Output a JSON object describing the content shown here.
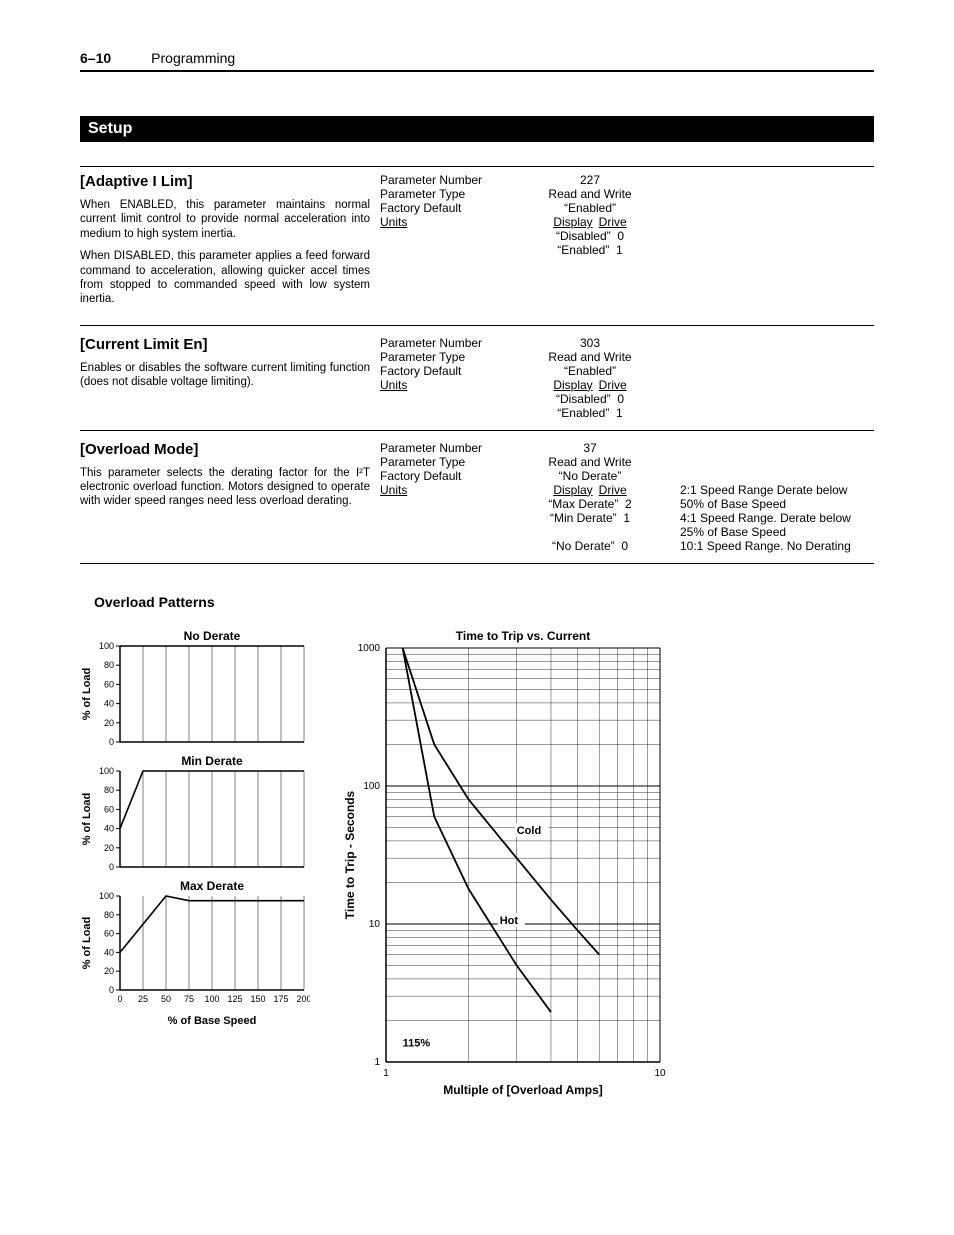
{
  "header": {
    "page_num": "6–10",
    "chapter": "Programming"
  },
  "section_title": "Setup",
  "labels": {
    "param_number": "Parameter Number",
    "param_type": "Parameter Type",
    "factory_default": "Factory Default",
    "units": "Units",
    "display": "Display",
    "drive": "Drive"
  },
  "params": [
    {
      "title": "[Adaptive I Lim]",
      "desc1": "When ENABLED, this parameter maintains normal current limit control to provide normal acceleration into medium to high system inertia.",
      "desc2": "When DISABLED, this parameter applies a feed forward command to acceleration, allowing quicker accel times from stopped to commanded speed with low system inertia.",
      "number": "227",
      "type": "Read and Write",
      "default": "“Enabled”",
      "unit_rows": [
        {
          "u": "“Disabled”",
          "d": "0",
          "desc": ""
        },
        {
          "u": "“Enabled”",
          "d": "1",
          "desc": ""
        }
      ]
    },
    {
      "title": "[Current Limit En]",
      "desc1": "Enables or disables the software current limiting function (does not disable voltage limiting).",
      "desc2": "",
      "number": "303",
      "type": "Read and Write",
      "default": "“Enabled”",
      "unit_rows": [
        {
          "u": "“Disabled”",
          "d": "0",
          "desc": ""
        },
        {
          "u": "“Enabled”",
          "d": "1",
          "desc": ""
        }
      ]
    },
    {
      "title": "[Overload Mode]",
      "desc1": "This parameter selects the derating factor for the I²T electronic overload function. Motors designed to operate with wider speed ranges need less overload derating.",
      "desc2": "",
      "number": "37",
      "type": "Read and Write",
      "default": "“No Derate”",
      "unit_rows": [
        {
          "u": "“Max Derate”",
          "d": "2",
          "desc": "2:1 Speed Range Derate below 50% of Base Speed"
        },
        {
          "u": "“Min Derate”",
          "d": "1",
          "desc": "4:1 Speed Range. Derate below 25% of Base Speed"
        },
        {
          "u": "“No Derate”",
          "d": "0",
          "desc": "10:1 Speed Range. No Derating"
        }
      ]
    }
  ],
  "patterns_title": "Overload Patterns",
  "chart_data": [
    {
      "type": "line",
      "title": "No Derate",
      "xlabel": "% of Base Speed",
      "ylabel": "% of Load",
      "xlim": [
        0,
        200
      ],
      "ylim": [
        0,
        100
      ],
      "xticks": [
        0,
        25,
        50,
        75,
        100,
        125,
        150,
        175,
        200
      ],
      "yticks": [
        0,
        20,
        40,
        60,
        80,
        100
      ],
      "series": [
        {
          "name": "load",
          "x": [
            0,
            200
          ],
          "y": [
            100,
            100
          ]
        }
      ]
    },
    {
      "type": "line",
      "title": "Min Derate",
      "xlabel": "% of Base Speed",
      "ylabel": "% of Load",
      "xlim": [
        0,
        200
      ],
      "ylim": [
        0,
        100
      ],
      "xticks": [
        0,
        25,
        50,
        75,
        100,
        125,
        150,
        175,
        200
      ],
      "yticks": [
        0,
        20,
        40,
        60,
        80,
        100
      ],
      "series": [
        {
          "name": "load",
          "x": [
            0,
            25,
            200
          ],
          "y": [
            40,
            100,
            100
          ]
        }
      ]
    },
    {
      "type": "line",
      "title": "Max Derate",
      "xlabel": "% of Base Speed",
      "ylabel": "% of Load",
      "xlim": [
        0,
        200
      ],
      "ylim": [
        0,
        100
      ],
      "xticks": [
        0,
        25,
        50,
        75,
        100,
        125,
        150,
        175,
        200
      ],
      "yticks": [
        0,
        20,
        40,
        60,
        80,
        100
      ],
      "series": [
        {
          "name": "load",
          "x": [
            0,
            50,
            75,
            200
          ],
          "y": [
            40,
            100,
            95,
            95
          ]
        }
      ]
    },
    {
      "type": "line",
      "title": "Time to Trip vs. Current",
      "xlabel": "Multiple of [Overload Amps]",
      "ylabel": "Time to Trip - Seconds",
      "xlim": [
        1,
        10
      ],
      "ylim": [
        1,
        1000
      ],
      "xscale": "log",
      "yscale": "log",
      "xticks": [
        1,
        10
      ],
      "yticks": [
        1,
        10,
        100,
        1000
      ],
      "annotations": [
        {
          "text": "Cold",
          "x": 3.0,
          "y": 45
        },
        {
          "text": "Hot",
          "x": 2.6,
          "y": 10
        },
        {
          "text": "115%",
          "x": 1.15,
          "y": 1.3
        }
      ],
      "series": [
        {
          "name": "Cold",
          "x": [
            1.15,
            1.5,
            2,
            3,
            4,
            5,
            6
          ],
          "y": [
            1000,
            200,
            80,
            30,
            15,
            9,
            6
          ]
        },
        {
          "name": "Hot",
          "x": [
            1.15,
            1.5,
            2,
            3,
            4
          ],
          "y": [
            1000,
            60,
            18,
            5,
            2.3
          ]
        }
      ]
    }
  ]
}
